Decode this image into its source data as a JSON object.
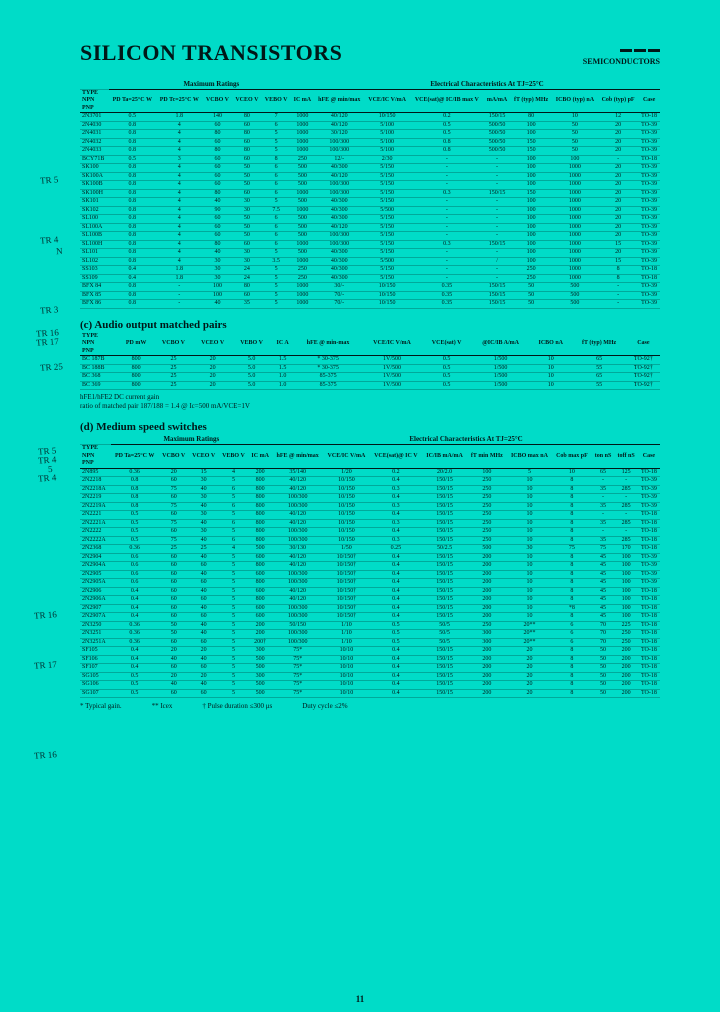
{
  "header": {
    "title": "SILICON TRANSISTORS",
    "brand": "SEMICONDUCTORS"
  },
  "annotations": [
    "TR 5",
    "TR 4",
    "N",
    "TR 3",
    "TR 16",
    "TR 17",
    "TR 25",
    "TR 5",
    "TR 4",
    "5",
    "TR 4",
    "TR 16",
    "TR 17",
    "TR 16"
  ],
  "table_a": {
    "super_left": "Maximum Ratings",
    "super_right": "Electrical Characteristics At TJ=25°C",
    "cols": [
      "TYPE\nNPN\nPNP",
      "PD Ta=25°C W",
      "PD Tc=25°C W",
      "VCBO V",
      "VCEO V",
      "VEBO V",
      "IC mA",
      "hFE @ min/max",
      "VCE/IC V/mA",
      "VCE(sat)@ IC/IB max V",
      "mA/mA",
      "fT (typ) MHz",
      "ICBO (typ) nA",
      "Cob (typ) pF",
      "Case"
    ],
    "rows": [
      [
        "2N3701",
        "0.5",
        "1.8",
        "140",
        "80",
        "7",
        "1000",
        "40/120",
        "10/150",
        "0.2",
        "150/15",
        "80",
        "10",
        "12",
        "TO-18"
      ],
      [
        "2N4030",
        "0.8",
        "4",
        "60",
        "60",
        "6",
        "1000",
        "40/120",
        "5/100",
        "0.5",
        "500/50",
        "100",
        "50",
        "20",
        "TO-39"
      ],
      [
        "2N4031",
        "0.8",
        "4",
        "80",
        "80",
        "5",
        "1000",
        "30/120",
        "5/100",
        "0.5",
        "500/50",
        "100",
        "50",
        "20",
        "TO-39"
      ],
      [
        "2N4032",
        "0.8",
        "4",
        "60",
        "60",
        "5",
        "1000",
        "100/300",
        "5/100",
        "0.8",
        "500/50",
        "150",
        "50",
        "20",
        "TO-39"
      ],
      [
        "2N4033",
        "0.8",
        "4",
        "80",
        "80",
        "5",
        "1000",
        "100/300",
        "5/100",
        "0.8",
        "500/50",
        "150",
        "50",
        "20",
        "TO-39"
      ],
      [
        "BCY71B",
        "0.5",
        "3",
        "60",
        "60",
        "8",
        "250",
        "12/-",
        "2/30",
        "-",
        "-",
        "100",
        "100",
        "-",
        "TO-18"
      ],
      [
        "SK100",
        "0.8",
        "4",
        "60",
        "50",
        "6",
        "500",
        "40/300",
        "5/150",
        "-",
        "-",
        "100",
        "1000",
        "20",
        "TO-39"
      ],
      [
        "SK100A",
        "0.8",
        "4",
        "60",
        "50",
        "6",
        "500",
        "40/120",
        "5/150",
        "-",
        "-",
        "100",
        "1000",
        "20",
        "TO-39"
      ],
      [
        "SK100B",
        "0.8",
        "4",
        "60",
        "50",
        "6",
        "500",
        "100/300",
        "5/150",
        "-",
        "-",
        "100",
        "1000",
        "20",
        "TO-39"
      ],
      [
        "SK100H",
        "0.8",
        "4",
        "80",
        "60",
        "6",
        "1000",
        "100/300",
        "5/150",
        "0.3",
        "150/15",
        "150",
        "1000",
        "20",
        "TO-39"
      ],
      [
        "SK101",
        "0.8",
        "4",
        "40",
        "30",
        "5",
        "500",
        "40/300",
        "5/150",
        "-",
        "-",
        "100",
        "1000",
        "20",
        "TO-39"
      ],
      [
        "SK102",
        "0.8",
        "4",
        "90",
        "30",
        "7.5",
        "1000",
        "40/300",
        "5/500",
        "-",
        "-",
        "100",
        "1000",
        "20",
        "TO-39"
      ],
      [
        "SL100",
        "0.8",
        "4",
        "60",
        "50",
        "6",
        "500",
        "40/300",
        "5/150",
        "-",
        "-",
        "100",
        "1000",
        "20",
        "TO-39"
      ],
      [
        "SL100A",
        "0.8",
        "4",
        "60",
        "50",
        "6",
        "500",
        "40/120",
        "5/150",
        "-",
        "-",
        "100",
        "1000",
        "20",
        "TO-39"
      ],
      [
        "SL100B",
        "0.8",
        "4",
        "60",
        "50",
        "6",
        "500",
        "100/300",
        "5/150",
        "-",
        "-",
        "100",
        "1000",
        "20",
        "TO-39"
      ],
      [
        "SL100H",
        "0.8",
        "4",
        "80",
        "60",
        "6",
        "1000",
        "100/300",
        "5/150",
        "0.3",
        "150/15",
        "100",
        "1000",
        "15",
        "TO-39"
      ],
      [
        "SL101",
        "0.8",
        "4",
        "40",
        "30",
        "5",
        "500",
        "40/300",
        "5/150",
        "-",
        "-",
        "100",
        "1000",
        "20",
        "TO-39"
      ],
      [
        "SL102",
        "0.8",
        "4",
        "30",
        "30",
        "3.5",
        "1000",
        "40/300",
        "5/500",
        "-",
        "/",
        "100",
        "1000",
        "15",
        "TO-39"
      ],
      [
        "SS103",
        "0.4",
        "1.8",
        "30",
        "24",
        "5",
        "250",
        "40/300",
        "5/150",
        "-",
        "-",
        "250",
        "1000",
        "8",
        "TO-18"
      ],
      [
        "SS109",
        "0.4",
        "1.8",
        "30",
        "24",
        "5",
        "250",
        "40/300",
        "5/150",
        "-",
        "-",
        "250",
        "1000",
        "8",
        "TO-18"
      ],
      [
        "BFX 84",
        "0.8",
        "-",
        "100",
        "80",
        "5",
        "1000",
        "30/-",
        "10/150",
        "0.35",
        "150/15",
        "50",
        "500",
        "-",
        "TO-39"
      ],
      [
        "BFX 85",
        "0.8",
        "-",
        "100",
        "60",
        "5",
        "1000",
        "70/-",
        "10/150",
        "0.35",
        "150/15",
        "50",
        "500",
        "-",
        "TO-39"
      ],
      [
        "BFX 86",
        "0.8",
        "-",
        "40",
        "35",
        "5",
        "1000",
        "70/-",
        "10/150",
        "0.35",
        "150/15",
        "50",
        "500",
        "-",
        "TO-39"
      ]
    ]
  },
  "section_c": {
    "title": "(c)  Audio output matched pairs",
    "cols": [
      "TYPE\nNPN\nPNP",
      "PD mW",
      "VCBO V",
      "VCEO V",
      "VEBO V",
      "IC A",
      "hFE @ min-max",
      "VCE/IC V/mA",
      "VCE(sat) V",
      "@IC/IB A/mA",
      "ICBO nA",
      "fT (typ) MHz",
      "Case"
    ],
    "rows": [
      [
        "BC 187B",
        "800",
        "25",
        "20",
        "5.0",
        "1.5",
        "* 30-375",
        "1V/500",
        "0.5",
        "1/500",
        "10",
        "65",
        "TO-92†"
      ],
      [
        "BC 188B",
        "800",
        "25",
        "20",
        "5.0",
        "1.5",
        "* 30-375",
        "1V/500",
        "0.5",
        "1/500",
        "10",
        "55",
        "TO-92†"
      ],
      [
        "BC 368",
        "800",
        "25",
        "20",
        "5.0",
        "1.0",
        "85-375",
        "1V/500",
        "0.5",
        "1/500",
        "10",
        "65",
        "TO-92†"
      ],
      [
        "BC 369",
        "800",
        "25",
        "20",
        "5.0",
        "1.0",
        "85-375",
        "1V/500",
        "0.5",
        "1/500",
        "10",
        "55",
        "TO-92†"
      ]
    ],
    "note": "hFE1/hFE2 DC current gain\nratio of matched pair 187/188  = 1.4 @ Ic=500 mA/VCE=1V"
  },
  "section_d": {
    "title": "(d)  Medium speed switches",
    "super_left": "Maximum Ratings",
    "super_right": "Electrical Characteristics At TJ=25°C",
    "cols": [
      "TYPE\nNPN\nPNP",
      "PD Ta=25°C W",
      "VCBO V",
      "VCEO V",
      "VEBO V",
      "IC mA",
      "hFE @ min/max",
      "VCE/IC V/mA",
      "VCE(sat)@ IC V",
      "IC/IB mA/mA",
      "fT min MHz",
      "ICBO max nA",
      "Cob max pF",
      "ton nS",
      "toff nS",
      "Case"
    ],
    "rows": [
      [
        "2N895",
        "0.36",
        "20",
        "15",
        "4",
        "200",
        "35/140",
        "1/20",
        "0.2",
        "20/2.0",
        "100",
        "5",
        "10",
        "65",
        "125",
        "TO-18"
      ],
      [
        "2N2218",
        "0.8",
        "60",
        "30",
        "5",
        "800",
        "40/120",
        "10/150",
        "0.4",
        "150/15",
        "250",
        "10",
        "8",
        "-",
        "-",
        "TO-39"
      ],
      [
        "2N2218A",
        "0.8",
        "75",
        "40",
        "6",
        "800",
        "40/120",
        "10/150",
        "0.3",
        "150/15",
        "250",
        "10",
        "8",
        "35",
        "285",
        "TO-39"
      ],
      [
        "2N2219",
        "0.8",
        "60",
        "30",
        "5",
        "800",
        "100/300",
        "10/150",
        "0.4",
        "150/15",
        "250",
        "10",
        "8",
        "-",
        "-",
        "TO-39"
      ],
      [
        "2N2219A",
        "0.8",
        "75",
        "40",
        "6",
        "800",
        "100/300",
        "10/150",
        "0.3",
        "150/15",
        "250",
        "10",
        "8",
        "35",
        "285",
        "TO-39"
      ],
      [
        "2N2221",
        "0.5",
        "60",
        "30",
        "5",
        "800",
        "40/120",
        "10/150",
        "0.4",
        "150/15",
        "250",
        "10",
        "8",
        "-",
        "-",
        "TO-18"
      ],
      [
        "2N2221A",
        "0.5",
        "75",
        "40",
        "6",
        "800",
        "40/120",
        "10/150",
        "0.3",
        "150/15",
        "250",
        "10",
        "8",
        "35",
        "285",
        "TO-18"
      ],
      [
        "2N2222",
        "0.5",
        "60",
        "30",
        "5",
        "800",
        "100/300",
        "10/150",
        "0.4",
        "150/15",
        "250",
        "10",
        "8",
        "-",
        "-",
        "TO-18"
      ],
      [
        "2N2222A",
        "0.5",
        "75",
        "40",
        "6",
        "800",
        "100/300",
        "10/150",
        "0.3",
        "150/15",
        "250",
        "10",
        "8",
        "35",
        "285",
        "TO-18"
      ],
      [
        "2N2368",
        "0.36",
        "25",
        "25",
        "4",
        "500",
        "30/130",
        "1/50",
        "0.25",
        "50/2.5",
        "500",
        "30",
        "75",
        "75",
        "170",
        "TO-18"
      ],
      [
        "2N2904",
        "0.6",
        "60",
        "40",
        "5",
        "600",
        "40/120",
        "10/150†",
        "0.4",
        "150/15",
        "200",
        "10",
        "8",
        "45",
        "100",
        "TO-39"
      ],
      [
        "2N2904A",
        "0.6",
        "60",
        "60",
        "5",
        "800",
        "40/120",
        "10/150†",
        "0.4",
        "150/15",
        "200",
        "10",
        "8",
        "45",
        "100",
        "TO-39"
      ],
      [
        "2N2905",
        "0.6",
        "60",
        "40",
        "5",
        "600",
        "100/300",
        "10/150†",
        "0.4",
        "150/15",
        "200",
        "10",
        "8",
        "45",
        "100",
        "TO-39"
      ],
      [
        "2N2905A",
        "0.6",
        "60",
        "60",
        "5",
        "800",
        "100/300",
        "10/150†",
        "0.4",
        "150/15",
        "200",
        "10",
        "8",
        "45",
        "100",
        "TO-39"
      ],
      [
        "2N2906",
        "0.4",
        "60",
        "40",
        "5",
        "600",
        "40/120",
        "10/150†",
        "0.4",
        "150/15",
        "200",
        "10",
        "8",
        "45",
        "100",
        "TO-18"
      ],
      [
        "2N2906A",
        "0.4",
        "60",
        "60",
        "5",
        "800",
        "40/120",
        "10/150†",
        "0.4",
        "150/15",
        "200",
        "10",
        "8",
        "45",
        "100",
        "TO-18"
      ],
      [
        "2N2907",
        "0.4",
        "60",
        "40",
        "5",
        "600",
        "100/300",
        "10/150†",
        "0.4",
        "150/15",
        "200",
        "10",
        "*8",
        "45",
        "100",
        "TO-18"
      ],
      [
        "2N2907A",
        "0.4",
        "60",
        "60",
        "5",
        "600",
        "100/300",
        "10/150†",
        "0.4",
        "150/15",
        "200",
        "10",
        "8",
        "45",
        "100",
        "TO-18"
      ],
      [
        "2N3250",
        "0.36",
        "50",
        "40",
        "5",
        "200",
        "50/150",
        "1/10",
        "0.5",
        "50/5",
        "250",
        "20**",
        "6",
        "70",
        "225",
        "TO-18"
      ],
      [
        "2N3251",
        "0.36",
        "50",
        "40",
        "5",
        "200",
        "100/300",
        "1/10",
        "0.5",
        "50/5",
        "300",
        "20**",
        "6",
        "70",
        "250",
        "TO-18"
      ],
      [
        "2N3251A",
        "0.36",
        "60",
        "60",
        "5",
        "200†",
        "100/300",
        "1/10",
        "0.5",
        "50/5",
        "300",
        "20**",
        "6",
        "70",
        "250",
        "TO-18"
      ],
      [
        "SF105",
        "0.4",
        "20",
        "20",
        "5",
        "300",
        "75*",
        "10/10",
        "0.4",
        "150/15",
        "200",
        "20",
        "8",
        "50",
        "200",
        "TO-18"
      ],
      [
        "SF106",
        "0.4",
        "40",
        "40",
        "5",
        "500",
        "75*",
        "10/10",
        "0.4",
        "150/15",
        "200",
        "20",
        "8",
        "50",
        "200",
        "TO-18"
      ],
      [
        "SF107",
        "0.4",
        "60",
        "60",
        "5",
        "500",
        "75*",
        "10/10",
        "0.4",
        "150/15",
        "200",
        "20",
        "8",
        "50",
        "200",
        "TO-18"
      ],
      [
        "SG105",
        "0.5",
        "20",
        "20",
        "5",
        "300",
        "75*",
        "10/10",
        "0.4",
        "150/15",
        "200",
        "20",
        "8",
        "50",
        "200",
        "TO-18"
      ],
      [
        "SG106",
        "0.5",
        "40",
        "40",
        "5",
        "500",
        "75*",
        "10/10",
        "0.4",
        "150/15",
        "200",
        "20",
        "8",
        "50",
        "200",
        "TO-18"
      ],
      [
        "SG107",
        "0.5",
        "60",
        "60",
        "5",
        "500",
        "75*",
        "10/10",
        "0.4",
        "150/15",
        "200",
        "20",
        "8",
        "50",
        "200",
        "TO-18"
      ]
    ],
    "footnotes": [
      "* Typical gain.",
      "** Icex",
      "† Pulse duration ≤300 μs",
      "Duty cycle ≤2%"
    ]
  },
  "pagenum": "11"
}
